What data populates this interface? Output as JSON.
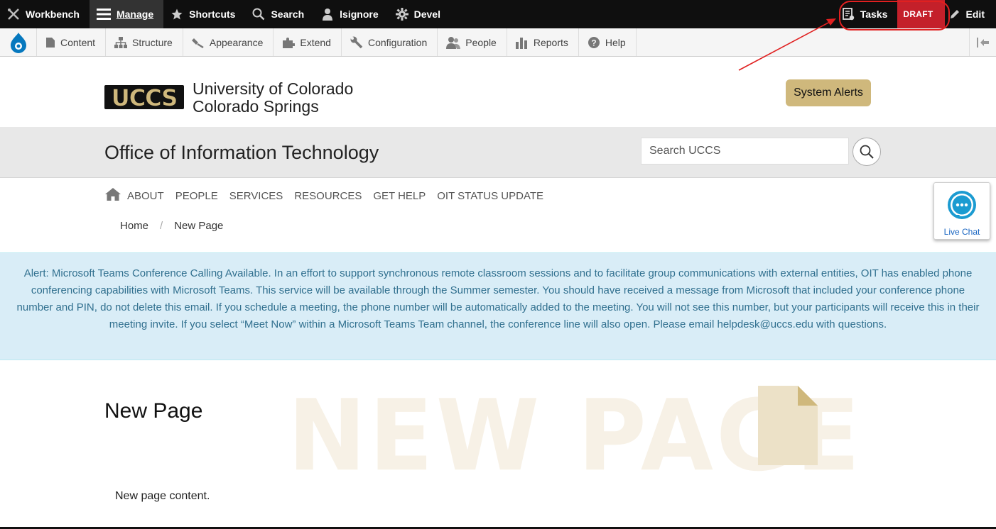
{
  "toolbar": {
    "items": [
      {
        "label": "Workbench",
        "icon": "wrench-cross-icon"
      },
      {
        "label": "Manage",
        "icon": "hamburger-icon"
      },
      {
        "label": "Shortcuts",
        "icon": "star-icon"
      },
      {
        "label": "Search",
        "icon": "search-icon"
      },
      {
        "label": "lsignore",
        "icon": "user-icon"
      },
      {
        "label": "Devel",
        "icon": "gear-icon"
      }
    ],
    "tasks_label": "Tasks",
    "draft_label": "DRAFT",
    "edit_label": "Edit"
  },
  "tray": {
    "items": [
      {
        "label": "Content",
        "icon": "document-icon"
      },
      {
        "label": "Structure",
        "icon": "sitemap-icon"
      },
      {
        "label": "Appearance",
        "icon": "brush-icon"
      },
      {
        "label": "Extend",
        "icon": "puzzle-icon"
      },
      {
        "label": "Configuration",
        "icon": "wrench-icon"
      },
      {
        "label": "People",
        "icon": "people-icon"
      },
      {
        "label": "Reports",
        "icon": "bar-chart-icon"
      },
      {
        "label": "Help",
        "icon": "help-icon"
      }
    ]
  },
  "header": {
    "logo_text": "UCCS",
    "university_line1": "University of Colorado",
    "university_line2": "Colorado Springs",
    "system_alerts_label": "System Alerts"
  },
  "band": {
    "department": "Office of Information Technology",
    "search_placeholder": "Search UCCS"
  },
  "nav": {
    "items": [
      "ABOUT",
      "PEOPLE",
      "SERVICES",
      "RESOURCES",
      "GET HELP",
      "OIT STATUS UPDATE"
    ]
  },
  "breadcrumb": {
    "home": "Home",
    "separator": "/",
    "current": "New Page"
  },
  "live_chat": {
    "label": "Live Chat"
  },
  "alert": {
    "text": "Alert: Microsoft Teams Conference Calling Available. In an effort to support synchronous remote classroom sessions and to facilitate group communications with external entities, OIT has enabled phone conferencing capabilities with Microsoft Teams. This service will be available through the Summer semester. You should have received a message from Microsoft that included your conference phone number and PIN, do not delete this email. If you schedule a meeting, the phone number will be automatically added to the meeting. You will not see this number, but your participants will receive this in their meeting invite. If you select “Meet Now” within a Microsoft Teams Team channel, the conference line will also open. Please email helpdesk@uccs.edu with questions."
  },
  "page": {
    "title": "New Page",
    "banner_word": "NEW PAGE",
    "content": "New page content."
  },
  "colors": {
    "toolbar_bg": "#0f0f0f",
    "draft_red": "#c4202a",
    "gold": "#cfb87c",
    "alert_bg": "#d9edf7",
    "alert_text": "#31708f",
    "annotation_red": "#e02020"
  }
}
